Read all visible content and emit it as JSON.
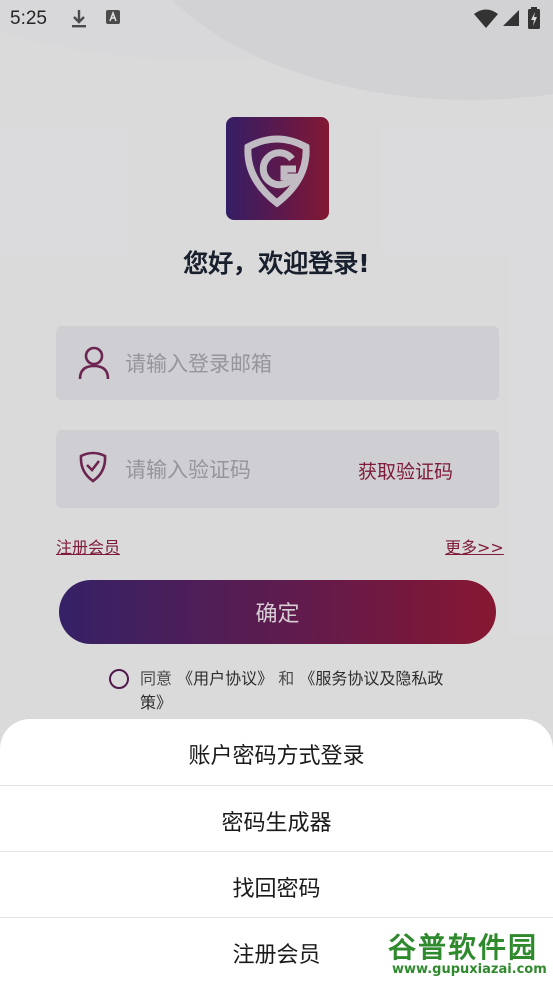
{
  "status_bar": {
    "time": "5:25"
  },
  "login": {
    "greeting": "您好，欢迎登录!",
    "email_placeholder": "请输入登录邮箱",
    "code_placeholder": "请输入验证码",
    "get_code": "获取验证码",
    "register_link": "注册会员",
    "more_link": "更多>>",
    "confirm_button": "确定",
    "agreement": {
      "agree": "同意",
      "user_agreement": "《用户协议》",
      "and": "和",
      "service_privacy": "《服务协议及隐私政策》"
    }
  },
  "sheet": {
    "options": [
      "账户密码方式登录",
      "密码生成器",
      "找回密码",
      "注册会员"
    ]
  },
  "watermark": {
    "title": "谷普软件园",
    "url": "www.gupuxiazai.com"
  },
  "colors": {
    "accent": "#8e1f3f",
    "gradient_start": "#3c2674",
    "gradient_end": "#981a38"
  }
}
